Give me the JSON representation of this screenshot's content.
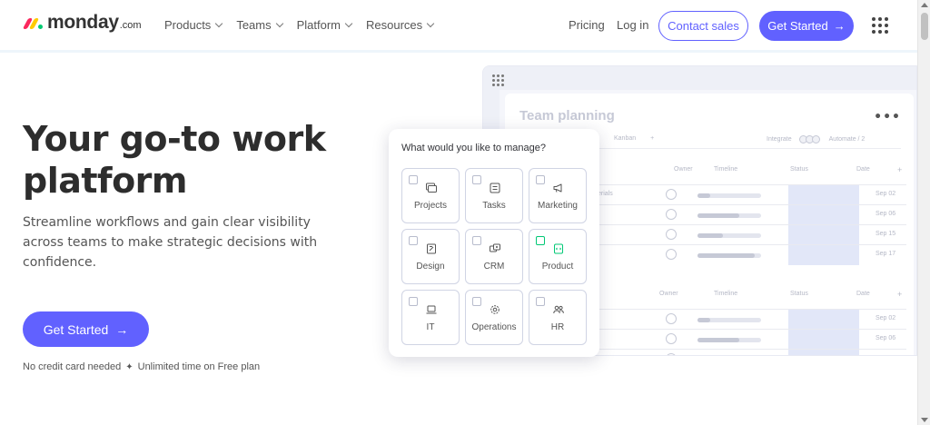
{
  "logo": {
    "word": "monday",
    "suffix": ".com"
  },
  "nav": {
    "items": [
      {
        "label": "Products"
      },
      {
        "label": "Teams"
      },
      {
        "label": "Platform"
      },
      {
        "label": "Resources"
      }
    ],
    "pricing": "Pricing",
    "login": "Log in",
    "contact_sales": "Contact sales",
    "get_started": "Get Started",
    "arrow": "→"
  },
  "hero": {
    "title": "Your go-to work platform",
    "subtitle": "Streamline workflows and gain clear visibility across teams to make strategic decisions with confidence.",
    "cta": "Get Started",
    "arrow": "→",
    "note_left": "No credit card needed",
    "note_sep": "✦",
    "note_right": "Unlimited time on Free plan"
  },
  "board": {
    "title": "Team planning",
    "more": "•••",
    "tab_kanban": "Kanban",
    "tab_add": "+",
    "integrate": "Integrate",
    "automate": "Automate / 2",
    "group1_cols": {
      "owner": "Owner",
      "timeline": "Timeline",
      "status": "Status",
      "date": "Date",
      "add": "+"
    },
    "group2_cols": {
      "owner": "Owner",
      "timeline": "Timeline",
      "status": "Status",
      "date": "Date",
      "add": "+"
    },
    "row_fragment": "erials",
    "group1_rows": [
      {
        "date": "Sep 02",
        "progress": 0.2
      },
      {
        "date": "Sep 06",
        "progress": 0.65
      },
      {
        "date": "Sep 15",
        "progress": 0.4
      },
      {
        "date": "Sep 17",
        "progress": 0.9
      }
    ],
    "group2_rows": [
      {
        "date": "Sep 02",
        "progress": 0.2
      },
      {
        "date": "Sep 06",
        "progress": 0.65
      },
      {
        "date": "Sep 15",
        "progress": 0.4
      }
    ]
  },
  "popup": {
    "question": "What would you like to manage?",
    "tiles": [
      {
        "label": "Projects",
        "icon": "projects-icon"
      },
      {
        "label": "Tasks",
        "icon": "tasks-icon"
      },
      {
        "label": "Marketing",
        "icon": "megaphone-icon"
      },
      {
        "label": "Design",
        "icon": "design-icon"
      },
      {
        "label": "CRM",
        "icon": "crm-icon"
      },
      {
        "label": "Product",
        "icon": "product-icon"
      },
      {
        "label": "IT",
        "icon": "laptop-icon"
      },
      {
        "label": "Operations",
        "icon": "gear-icon"
      },
      {
        "label": "HR",
        "icon": "people-icon"
      }
    ]
  },
  "colors": {
    "brand": "#6161ff",
    "logo_red": "#fb275d",
    "logo_yellow": "#ffcb00",
    "logo_green": "#00ca72",
    "product_accent": "#00c875"
  }
}
